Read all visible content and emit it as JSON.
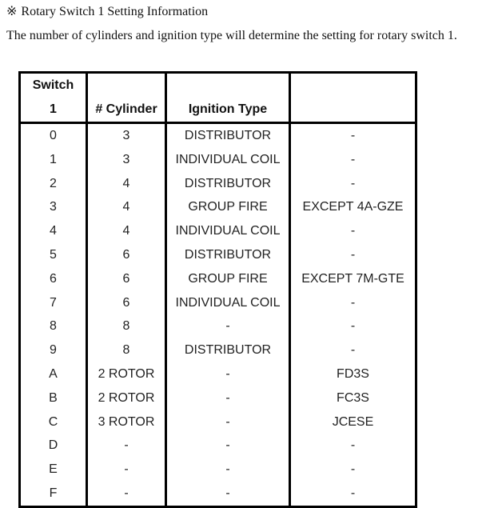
{
  "document": {
    "heading_mark": "※",
    "heading": "Rotary Switch 1 Setting Information",
    "intro": "The number of cylinders and ignition type will determine the setting for rotary switch 1."
  },
  "table": {
    "headers": {
      "switch_line1": "Switch",
      "switch_line2": "1",
      "cylinder": "# Cylinder",
      "ignition": "Ignition Type",
      "note": ""
    },
    "rows": [
      {
        "switch": "0",
        "cylinder": "3",
        "ignition": "DISTRIBUTOR",
        "note": "-"
      },
      {
        "switch": "1",
        "cylinder": "3",
        "ignition": "INDIVIDUAL COIL",
        "note": "-"
      },
      {
        "switch": "2",
        "cylinder": "4",
        "ignition": "DISTRIBUTOR",
        "note": "-"
      },
      {
        "switch": "3",
        "cylinder": "4",
        "ignition": "GROUP FIRE",
        "note": "EXCEPT 4A-GZE"
      },
      {
        "switch": "4",
        "cylinder": "4",
        "ignition": "INDIVIDUAL COIL",
        "note": "-"
      },
      {
        "switch": "5",
        "cylinder": "6",
        "ignition": "DISTRIBUTOR",
        "note": "-"
      },
      {
        "switch": "6",
        "cylinder": "6",
        "ignition": "GROUP FIRE",
        "note": "EXCEPT 7M-GTE"
      },
      {
        "switch": "7",
        "cylinder": "6",
        "ignition": "INDIVIDUAL COIL",
        "note": "-"
      },
      {
        "switch": "8",
        "cylinder": "8",
        "ignition": "-",
        "note": "-"
      },
      {
        "switch": "9",
        "cylinder": "8",
        "ignition": "DISTRIBUTOR",
        "note": "-"
      },
      {
        "switch": "A",
        "cylinder": "2 ROTOR",
        "ignition": "-",
        "note": "FD3S"
      },
      {
        "switch": "B",
        "cylinder": "2 ROTOR",
        "ignition": "-",
        "note": "FC3S"
      },
      {
        "switch": "C",
        "cylinder": "3 ROTOR",
        "ignition": "-",
        "note": "JCESE"
      },
      {
        "switch": "D",
        "cylinder": "-",
        "ignition": "-",
        "note": "-"
      },
      {
        "switch": "E",
        "cylinder": "-",
        "ignition": "-",
        "note": "-"
      },
      {
        "switch": "F",
        "cylinder": "-",
        "ignition": "-",
        "note": "-"
      }
    ]
  }
}
